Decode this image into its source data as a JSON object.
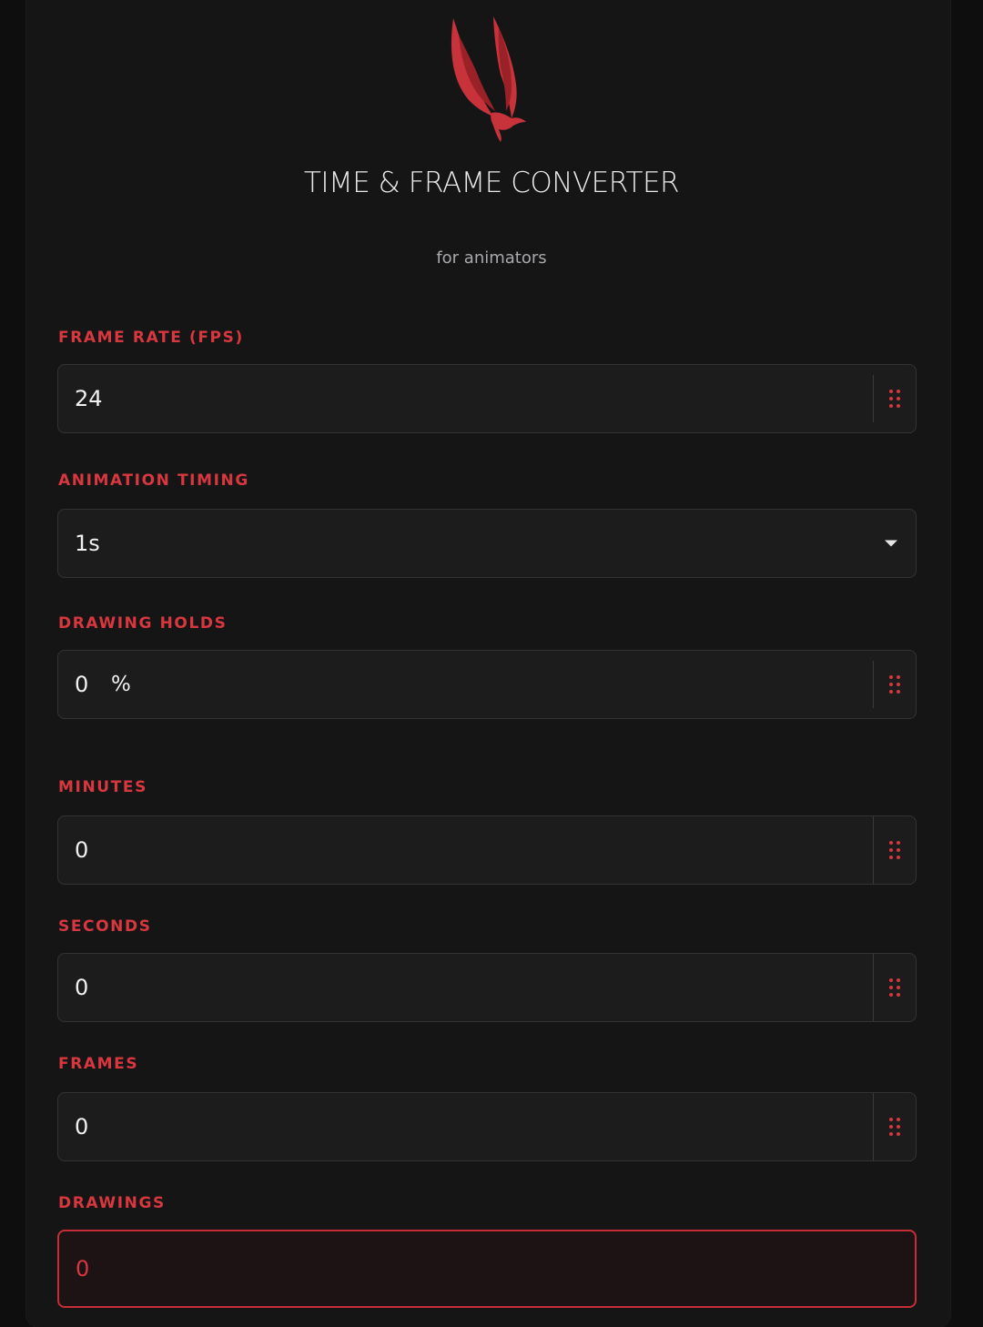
{
  "header": {
    "title": "TIME & FRAME CONVERTER",
    "subtitle": "for animators",
    "logo_icon": "phoenix-bird-icon",
    "accent_color": "#d9373f"
  },
  "fields": {
    "fps": {
      "label": "FRAME RATE (FPS)",
      "value": "24",
      "handle_icon": "drag-handle-icon"
    },
    "timing": {
      "label": "ANIMATION TIMING",
      "value": "1s",
      "icon": "chevron-down-icon"
    },
    "holds": {
      "label": "DRAWING HOLDS",
      "value": "0",
      "suffix": "%",
      "handle_icon": "drag-handle-icon"
    },
    "minutes": {
      "label": "MINUTES",
      "value": "0",
      "handle_icon": "drag-handle-icon"
    },
    "seconds": {
      "label": "SECONDS",
      "value": "0",
      "handle_icon": "drag-handle-icon"
    },
    "frames": {
      "label": "FRAMES",
      "value": "0",
      "handle_icon": "drag-handle-icon"
    },
    "drawings": {
      "label": "DRAWINGS",
      "value": "0"
    }
  }
}
